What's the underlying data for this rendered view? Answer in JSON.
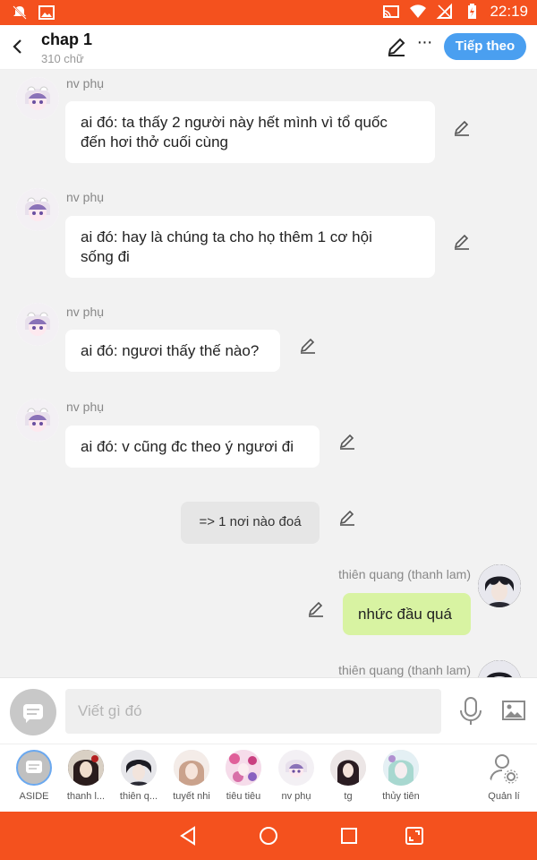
{
  "status_bar": {
    "time": "22:19"
  },
  "header": {
    "title": "chap 1",
    "subtitle": "310 chữ",
    "next_label": "Tiếp theo"
  },
  "messages": [
    {
      "sender": "nv phụ",
      "line1": "ai đó: ta thấy 2 người này hết mình vì tổ quốc",
      "line2": "đến hơi thở cuối cùng"
    },
    {
      "sender": "nv phụ",
      "line1": "ai đó: hay là chúng ta cho họ thêm 1 cơ hội",
      "line2": "sống đi"
    },
    {
      "sender": "nv phụ",
      "text": "ai đó: ngươi thấy thế nào?"
    },
    {
      "sender": "nv phụ",
      "text": "ai đó: v cũng đc theo ý ngươi đi"
    },
    {
      "text": "=> 1 nơi nào đoá"
    },
    {
      "sender": "thiên quang (thanh lam)",
      "text": "nhức đầu quá"
    },
    {
      "sender": "thiên quang (thanh lam)"
    }
  ],
  "composer": {
    "placeholder": "Viết gì đó"
  },
  "characters": [
    {
      "name": "ASIDE"
    },
    {
      "name": "thanh l..."
    },
    {
      "name": "thiên q..."
    },
    {
      "name": "tuyết nhi"
    },
    {
      "name": "tiêu tiêu"
    },
    {
      "name": "nv phụ"
    },
    {
      "name": "tg"
    },
    {
      "name": "thủy tiên"
    },
    {
      "name": "Quản lí"
    }
  ],
  "colors": {
    "accent": "#f4511e",
    "button_blue": "#4a9ff0",
    "my_bubble": "#d8f3a2"
  }
}
